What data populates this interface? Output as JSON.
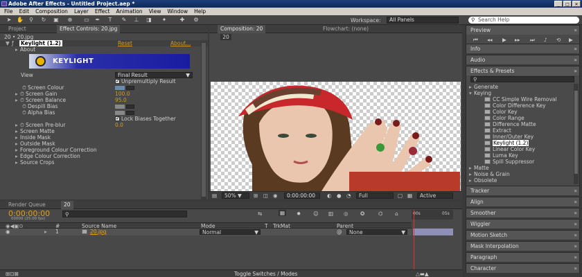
{
  "window": {
    "title": "Adobe After Effects - Untitled Project.aep *",
    "buttons": [
      "_",
      "□",
      "✕"
    ]
  },
  "menu": [
    "File",
    "Edit",
    "Composition",
    "Layer",
    "Effect",
    "Animation",
    "View",
    "Window",
    "Help"
  ],
  "toolbar": {
    "workspace_label": "Workspace:",
    "workspace_value": "All Panels",
    "search_placeholder": "Search Help"
  },
  "left_panel": {
    "tabs": [
      "Project",
      "Effect Controls: 20.jpg"
    ],
    "breadcrumb": "20 • 20.jpg",
    "effect_name": "Keylight (1.2)",
    "reset_label": "Reset",
    "about_label": "About...",
    "about_row": "About",
    "logo_text": "KEYLIGHT",
    "view_label": "View",
    "view_value": "Final Result",
    "unpremultiply_label": "Unpremultiply Result",
    "screen_colour_label": "Screen Colour",
    "screen_gain_label": "Screen Gain",
    "screen_gain_value": "100.0",
    "screen_balance_label": "Screen Balance",
    "screen_balance_value": "95.0",
    "despill_label": "Despill Bias",
    "alpha_label": "Alpha Bias",
    "lock_label": "Lock Biases Together",
    "preblur_label": "Screen Pre-blur",
    "preblur_value": "0.0",
    "groups": [
      "Screen Matte",
      "Inside Mask",
      "Outside Mask",
      "Foreground Colour Correction",
      "Edge Colour Correction",
      "Source Crops"
    ],
    "screen_colour": "#6a8ab0"
  },
  "comp_panel": {
    "tabs": [
      "Composition: 20",
      "Flowchart: (none)"
    ],
    "comp_chip": "20",
    "zoom": "50%",
    "timecode": "0:00:00:00",
    "resolution": "Full",
    "camera": "Active"
  },
  "right_panels": {
    "preview": "Preview",
    "info": "Info",
    "audio": "Audio",
    "effects_presets": "Effects & Presets",
    "search_glyph": "⚲",
    "tree": [
      {
        "label": "Generate",
        "kind": "folder"
      },
      {
        "label": "Keying",
        "kind": "folder-open"
      },
      {
        "label": "CC Simple Wire Removal",
        "kind": "effect"
      },
      {
        "label": "Color Difference Key",
        "kind": "effect"
      },
      {
        "label": "Color Key",
        "kind": "effect"
      },
      {
        "label": "Color Range",
        "kind": "effect"
      },
      {
        "label": "Difference Matte",
        "kind": "effect"
      },
      {
        "label": "Extract",
        "kind": "effect"
      },
      {
        "label": "Inner/Outer Key",
        "kind": "effect"
      },
      {
        "label": "Keylight (1.2)",
        "kind": "effect-selected"
      },
      {
        "label": "Linear Color Key",
        "kind": "effect"
      },
      {
        "label": "Luma Key",
        "kind": "effect"
      },
      {
        "label": "Spill Suppressor",
        "kind": "effect"
      },
      {
        "label": "Matte",
        "kind": "folder"
      },
      {
        "label": "Noise & Grain",
        "kind": "folder"
      },
      {
        "label": "Obsolete",
        "kind": "folder"
      }
    ],
    "collapsed": [
      "Tracker",
      "Align",
      "Smoother",
      "Wiggler",
      "Motion Sketch",
      "Mask Interpolation",
      "Paragraph",
      "Character"
    ]
  },
  "timeline": {
    "tabs": [
      "Render Queue",
      "20"
    ],
    "timecode": "0:00:00:00",
    "fps": "00000 (25.00 fps)",
    "search_glyph": "⚲",
    "columns": {
      "num": "#",
      "source": "Source Name",
      "mode": "Mode",
      "t": "T",
      "trkmat": "TrkMat",
      "parent": "Parent"
    },
    "layer": {
      "num": "1",
      "name": "20.jpg",
      "mode": "Normal",
      "parent": "None"
    },
    "ruler_labels": [
      "00s",
      "05s"
    ],
    "footer": "Toggle Switches / Modes"
  }
}
